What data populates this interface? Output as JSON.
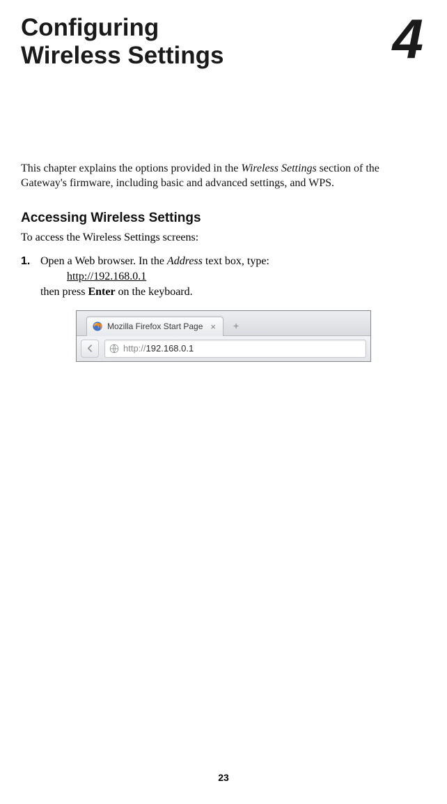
{
  "header": {
    "chapter_title_line1": "Configuring",
    "chapter_title_line2": "Wireless Settings",
    "chapter_number": "4"
  },
  "intro_pre": "This chapter explains the options provided in the ",
  "intro_italic": "Wireless Settings",
  "intro_post": " section of the Gateway's firmware, including basic and advanced settings, and WPS.",
  "section_heading": "Accessing Wireless Settings",
  "section_intro": "To access the Wireless Settings screens:",
  "step1": {
    "num": "1.",
    "pre": "Open a Web browser. In the ",
    "italic": "Address",
    "post": " text box, type:",
    "url": "http://192.168.0.1",
    "line3a": "then press ",
    "bold": "Enter",
    "line3b": " on the keyboard."
  },
  "browser": {
    "tab_title": "Mozilla Firefox Start Page",
    "new_tab": "+",
    "close": "×",
    "addr_prefix": "http://",
    "addr_ip": "192.168.0.1"
  },
  "page_number": "23"
}
